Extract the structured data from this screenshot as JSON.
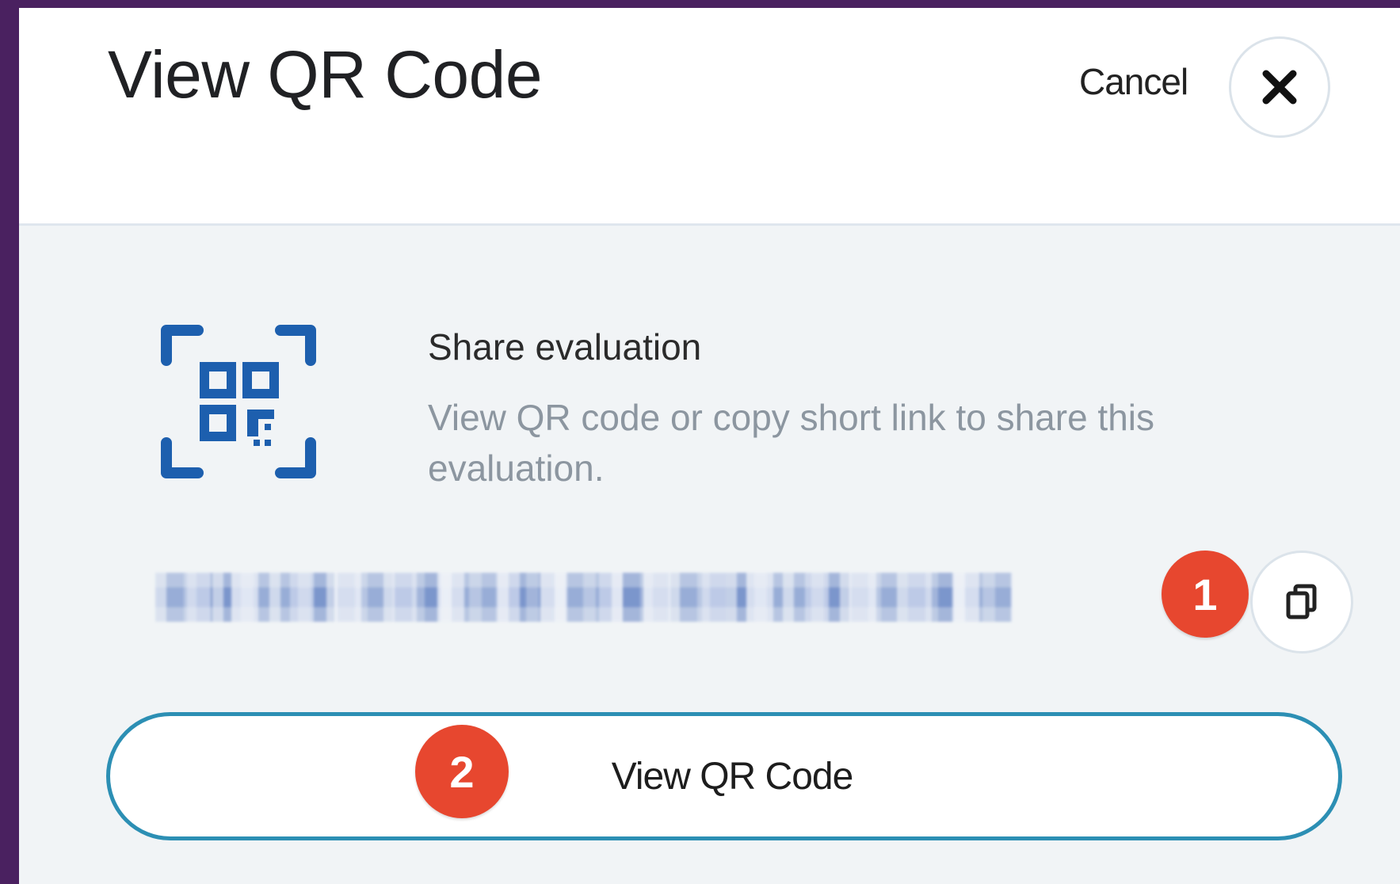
{
  "dialog": {
    "title": "View QR Code",
    "cancel_label": "Cancel",
    "close_icon": "close-icon"
  },
  "share": {
    "icon": "qr-code-icon",
    "title": "Share evaluation",
    "description": "View QR code or copy short link to share this evaluation.",
    "short_link_display": "redacted short link",
    "copy_icon": "copy-icon"
  },
  "actions": {
    "view_qr_label": "View QR Code"
  },
  "annotations": {
    "badge_1": "1",
    "badge_2": "2"
  },
  "colors": {
    "background_outer": "#4a2160",
    "body_bg": "#f1f4f6",
    "icon_blue": "#1d5fae",
    "button_border": "#2c8fb4",
    "badge_red": "#e7472f"
  }
}
